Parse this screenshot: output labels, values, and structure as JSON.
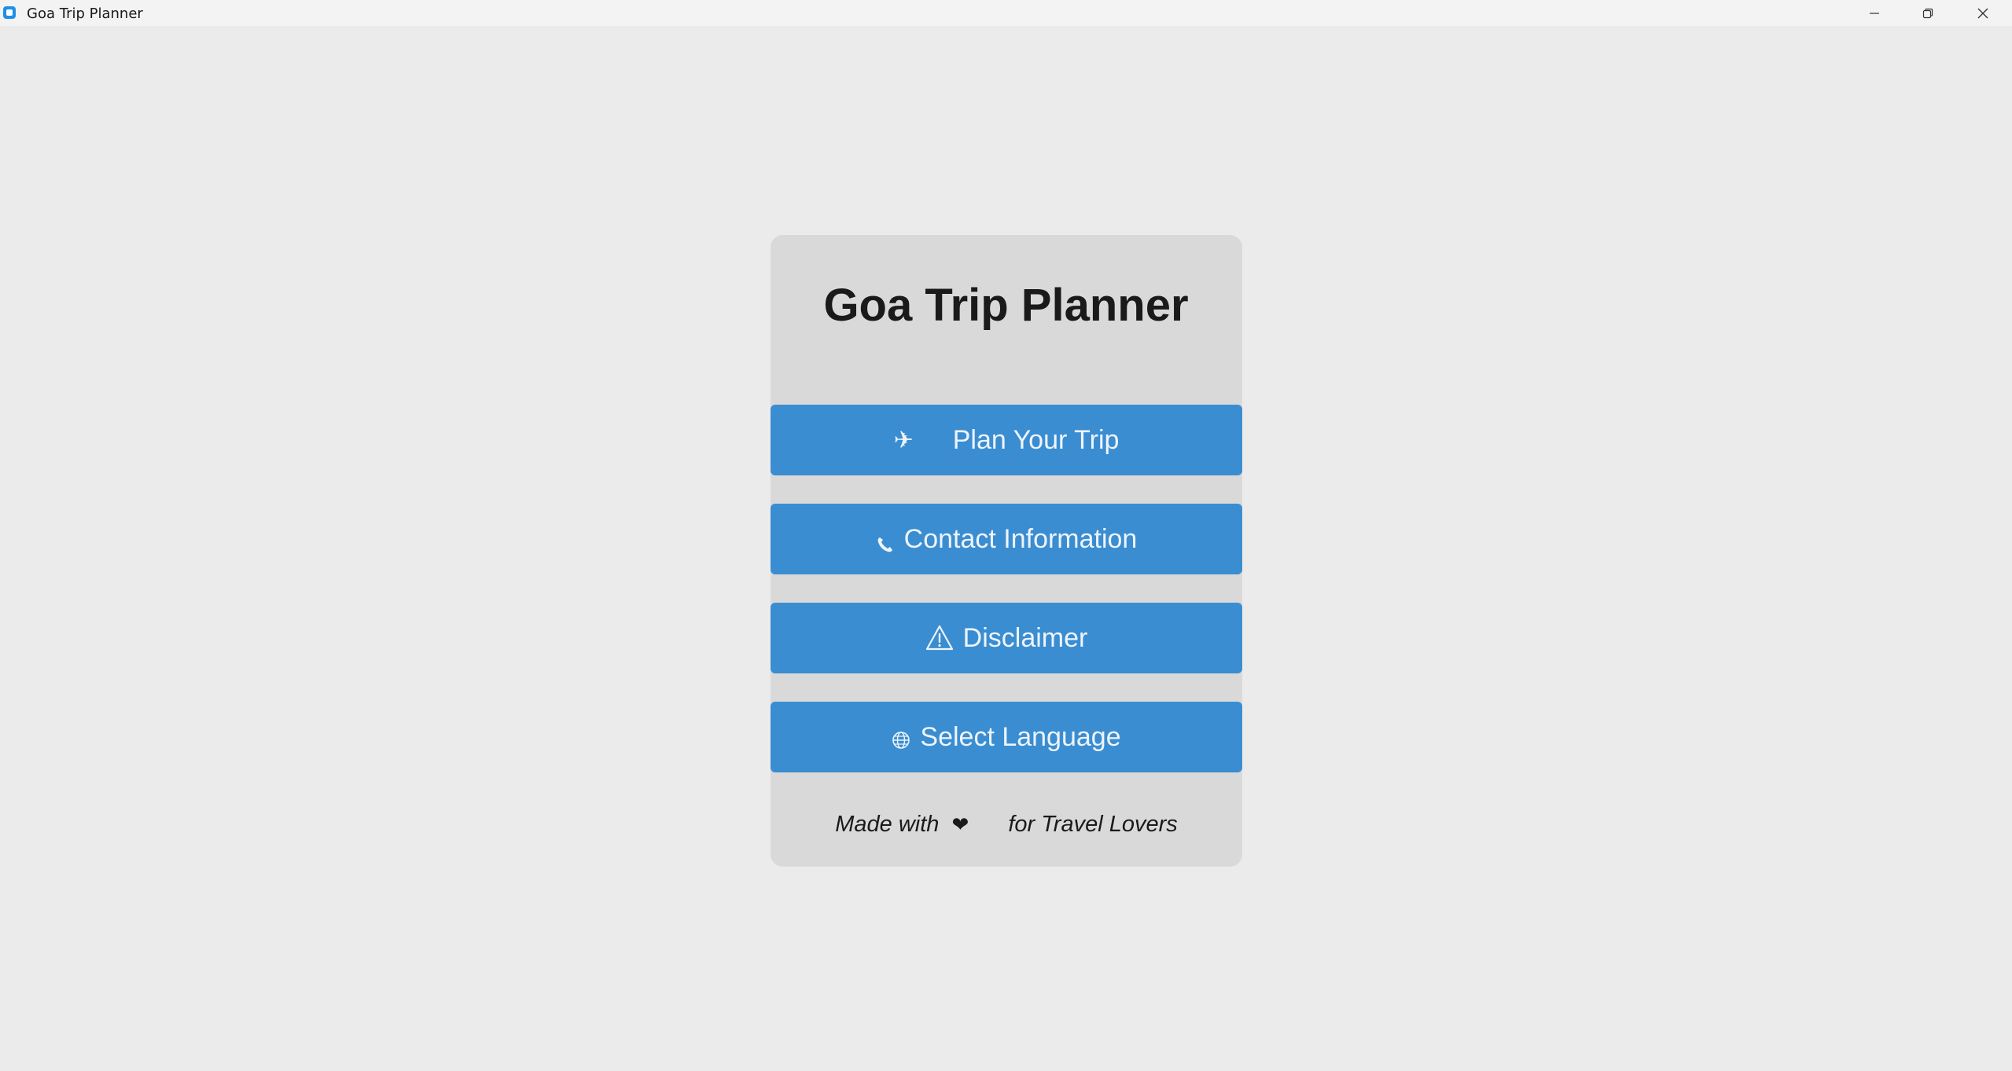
{
  "window": {
    "title": "Goa Trip Planner",
    "icon": "app-icon",
    "controls": [
      "minimize-icon",
      "restore-icon",
      "close-icon"
    ]
  },
  "card": {
    "title": "Goa Trip Planner",
    "buttons": [
      {
        "label": "Plan Your Trip",
        "icon": "airplane-icon",
        "glyph": "✈"
      },
      {
        "label": "Contact Information",
        "icon": "phone-icon"
      },
      {
        "label": "Disclaimer",
        "icon": "warning-icon"
      },
      {
        "label": "Select Language",
        "icon": "globe-icon"
      }
    ],
    "footer": {
      "before": "Made with",
      "heart": "❤",
      "after": "for Travel Lovers"
    }
  },
  "colors": {
    "background": "#ebebeb",
    "card": "#d9d9d9",
    "button": "#3a8dd1",
    "button_text": "#eef4fb",
    "title_text": "#1a1a1a"
  }
}
